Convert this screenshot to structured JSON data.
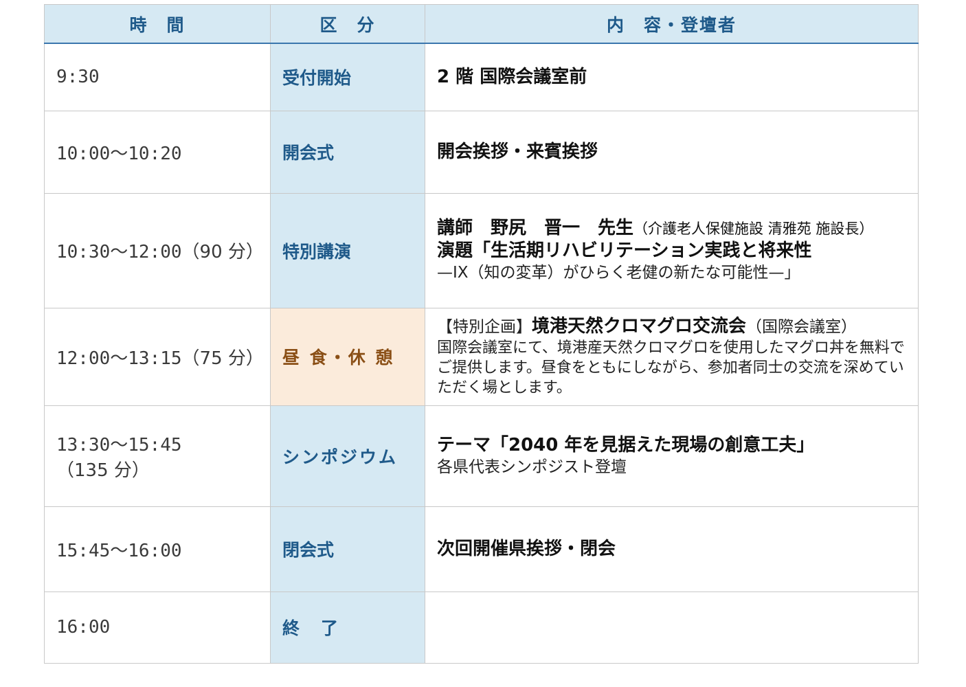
{
  "header": {
    "time": "時　間",
    "category": "区　分",
    "content": "内　容・登壇者"
  },
  "rows": [
    {
      "time": "9:30",
      "category": "受付開始",
      "content": {
        "main": "2 階 国際会議室前"
      }
    },
    {
      "time": "10:00〜10:20",
      "category": "開会式",
      "content": {
        "main": "開会挨拶・来賓挨拶"
      }
    },
    {
      "time": "10:30〜12:00",
      "duration": "（90 分）",
      "category": "特別講演",
      "content": {
        "lecturer": "講師　野尻　晋一　先生",
        "lecturer_affiliation": "（介護老人保健施設 清雅苑 施設長）",
        "title": "演題「生活期リハビリテーション実践と将来性",
        "subtitle": "—IX（知の変革）がひらく老健の新たな可能性—」"
      }
    },
    {
      "time": "12:00〜13:15",
      "duration": "（75 分）",
      "category": "昼 食・休 憩",
      "content": {
        "tag": "【特別企画】",
        "event": "境港天然クロマグロ交流会",
        "place": "（国際会議室）",
        "description": "国際会議室にて、境港産天然クロマグロを使用したマグロ丼を無料でご提供します。昼食をともにしながら、参加者同士の交流を深めていただく場とします。"
      }
    },
    {
      "time": "13:30〜15:45",
      "duration": "（135 分）",
      "category": "シンポジウム",
      "content": {
        "theme": "テーマ「2040 年を見据えた現場の創意工夫」",
        "note": "各県代表シンポジスト登壇"
      }
    },
    {
      "time": "15:45〜16:00",
      "category": "閉会式",
      "content": {
        "main": "次回開催県挨拶・閉会"
      }
    },
    {
      "time": "16:00",
      "category": "終　了",
      "content": {
        "main": ""
      }
    }
  ]
}
